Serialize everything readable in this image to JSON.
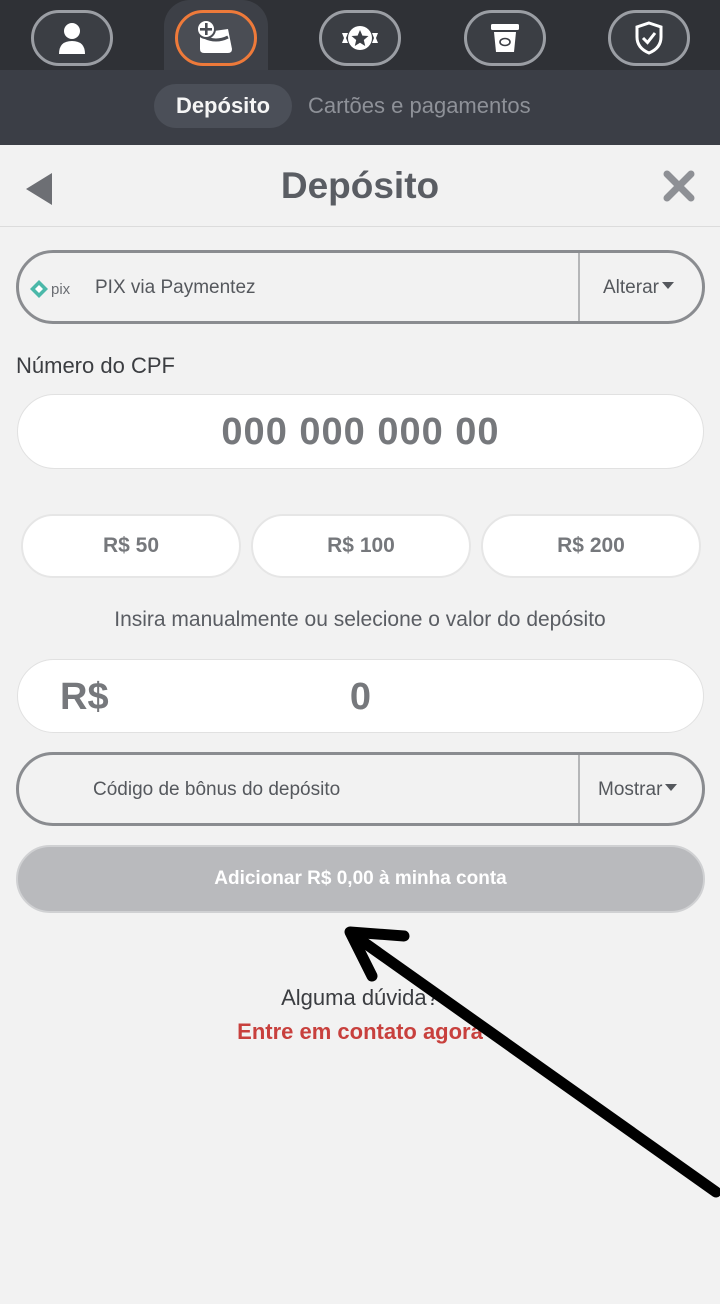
{
  "topnav": {
    "items": [
      {
        "name": "profile",
        "icon": "user-icon"
      },
      {
        "name": "wallet",
        "icon": "wallet-plus-icon",
        "active": true
      },
      {
        "name": "rewards",
        "icon": "star-badge-icon"
      },
      {
        "name": "vouchers",
        "icon": "ticket-icon"
      },
      {
        "name": "security",
        "icon": "shield-check-icon"
      }
    ],
    "active_color": "#ee7a3a"
  },
  "subnav": {
    "tabs": [
      {
        "label": "Depósito",
        "active": true
      },
      {
        "label": "Cartões e pagamentos",
        "active": false
      }
    ]
  },
  "header": {
    "title": "Depósito",
    "back_icon": "back-triangle-icon",
    "close_icon": "close-icon"
  },
  "payment_method": {
    "logo_text": "pix",
    "label": "PIX via Paymentez",
    "action": "Alterar"
  },
  "cpf": {
    "label": "Número do CPF",
    "placeholder": "000 000 000 00"
  },
  "quick_amounts": [
    "R$ 50",
    "R$ 100",
    "R$ 200"
  ],
  "hint": "Insira manualmente ou selecione o valor do depósito",
  "amount": {
    "currency": "R$",
    "value": "0"
  },
  "bonus": {
    "label": "Código de bônus do depósito",
    "action": "Mostrar"
  },
  "submit_label": "Adicionar R$ 0,00 à minha conta",
  "help": {
    "question": "Alguma dúvida?",
    "contact": "Entre em contato agora"
  },
  "colors": {
    "topbar_bg": "#2f3136",
    "subbar_bg": "#3b3e46",
    "page_bg": "#f2f2f2",
    "accent_red": "#c8403d",
    "disabled_button": "#b9babd"
  }
}
